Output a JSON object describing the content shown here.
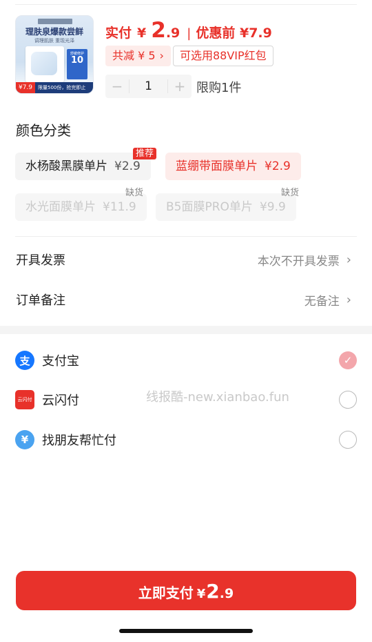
{
  "product": {
    "thumb_title": "理肤泉爆款尝鲜",
    "thumb_sub": "调理肌肤 重现光泽",
    "thumb_box_top": "舒缓修护",
    "thumb_box_num": "10",
    "thumb_price": "¥7.9",
    "thumb_note": "限量500份，抢完即止",
    "price_label": "实付",
    "price_yen": "¥",
    "price_int": "2",
    "price_dec": ".9",
    "price_sep": "|",
    "price_orig": "优惠前 ¥7.9",
    "discount_text": "共减 ¥ 5",
    "vip_text": "可选用88VIP红包",
    "quantity": "1",
    "minus": "−",
    "plus": "+",
    "limit_text": "限购1件"
  },
  "color_category": {
    "title": "颜色分类",
    "options": [
      {
        "name": "水杨酸黑膜单片",
        "price": "¥2.9",
        "badge": "推荐",
        "state": "normal"
      },
      {
        "name": "蓝绷带面膜单片",
        "price": "¥2.9",
        "badge": "",
        "state": "selected"
      },
      {
        "name": "水光面膜单片",
        "price": "¥11.9",
        "badge": "缺货",
        "state": "disabled"
      },
      {
        "name": "B5面膜PRO单片",
        "price": "¥9.9",
        "badge": "缺货",
        "state": "disabled"
      }
    ]
  },
  "invoice": {
    "label": "开具发票",
    "value": "本次不开具发票"
  },
  "remark": {
    "label": "订单备注",
    "value": "无备注"
  },
  "payment": {
    "methods": [
      {
        "label": "支付宝",
        "icon": "alipay-icon",
        "glyph": "支",
        "selected": true
      },
      {
        "label": "云闪付",
        "icon": "unionpay-icon",
        "glyph": "云闪付",
        "selected": false
      },
      {
        "label": "找朋友帮忙付",
        "icon": "friend-pay-icon",
        "glyph": "¥",
        "selected": false
      }
    ]
  },
  "watermark": "线报酷-new.xianbao.fun",
  "pay_button": {
    "label": "立即支付",
    "yen": "¥",
    "int": "2",
    "dec": ".9"
  },
  "colors": {
    "accent": "#e8312a",
    "accent_light": "#fdecea",
    "alipay": "#1677ff"
  }
}
